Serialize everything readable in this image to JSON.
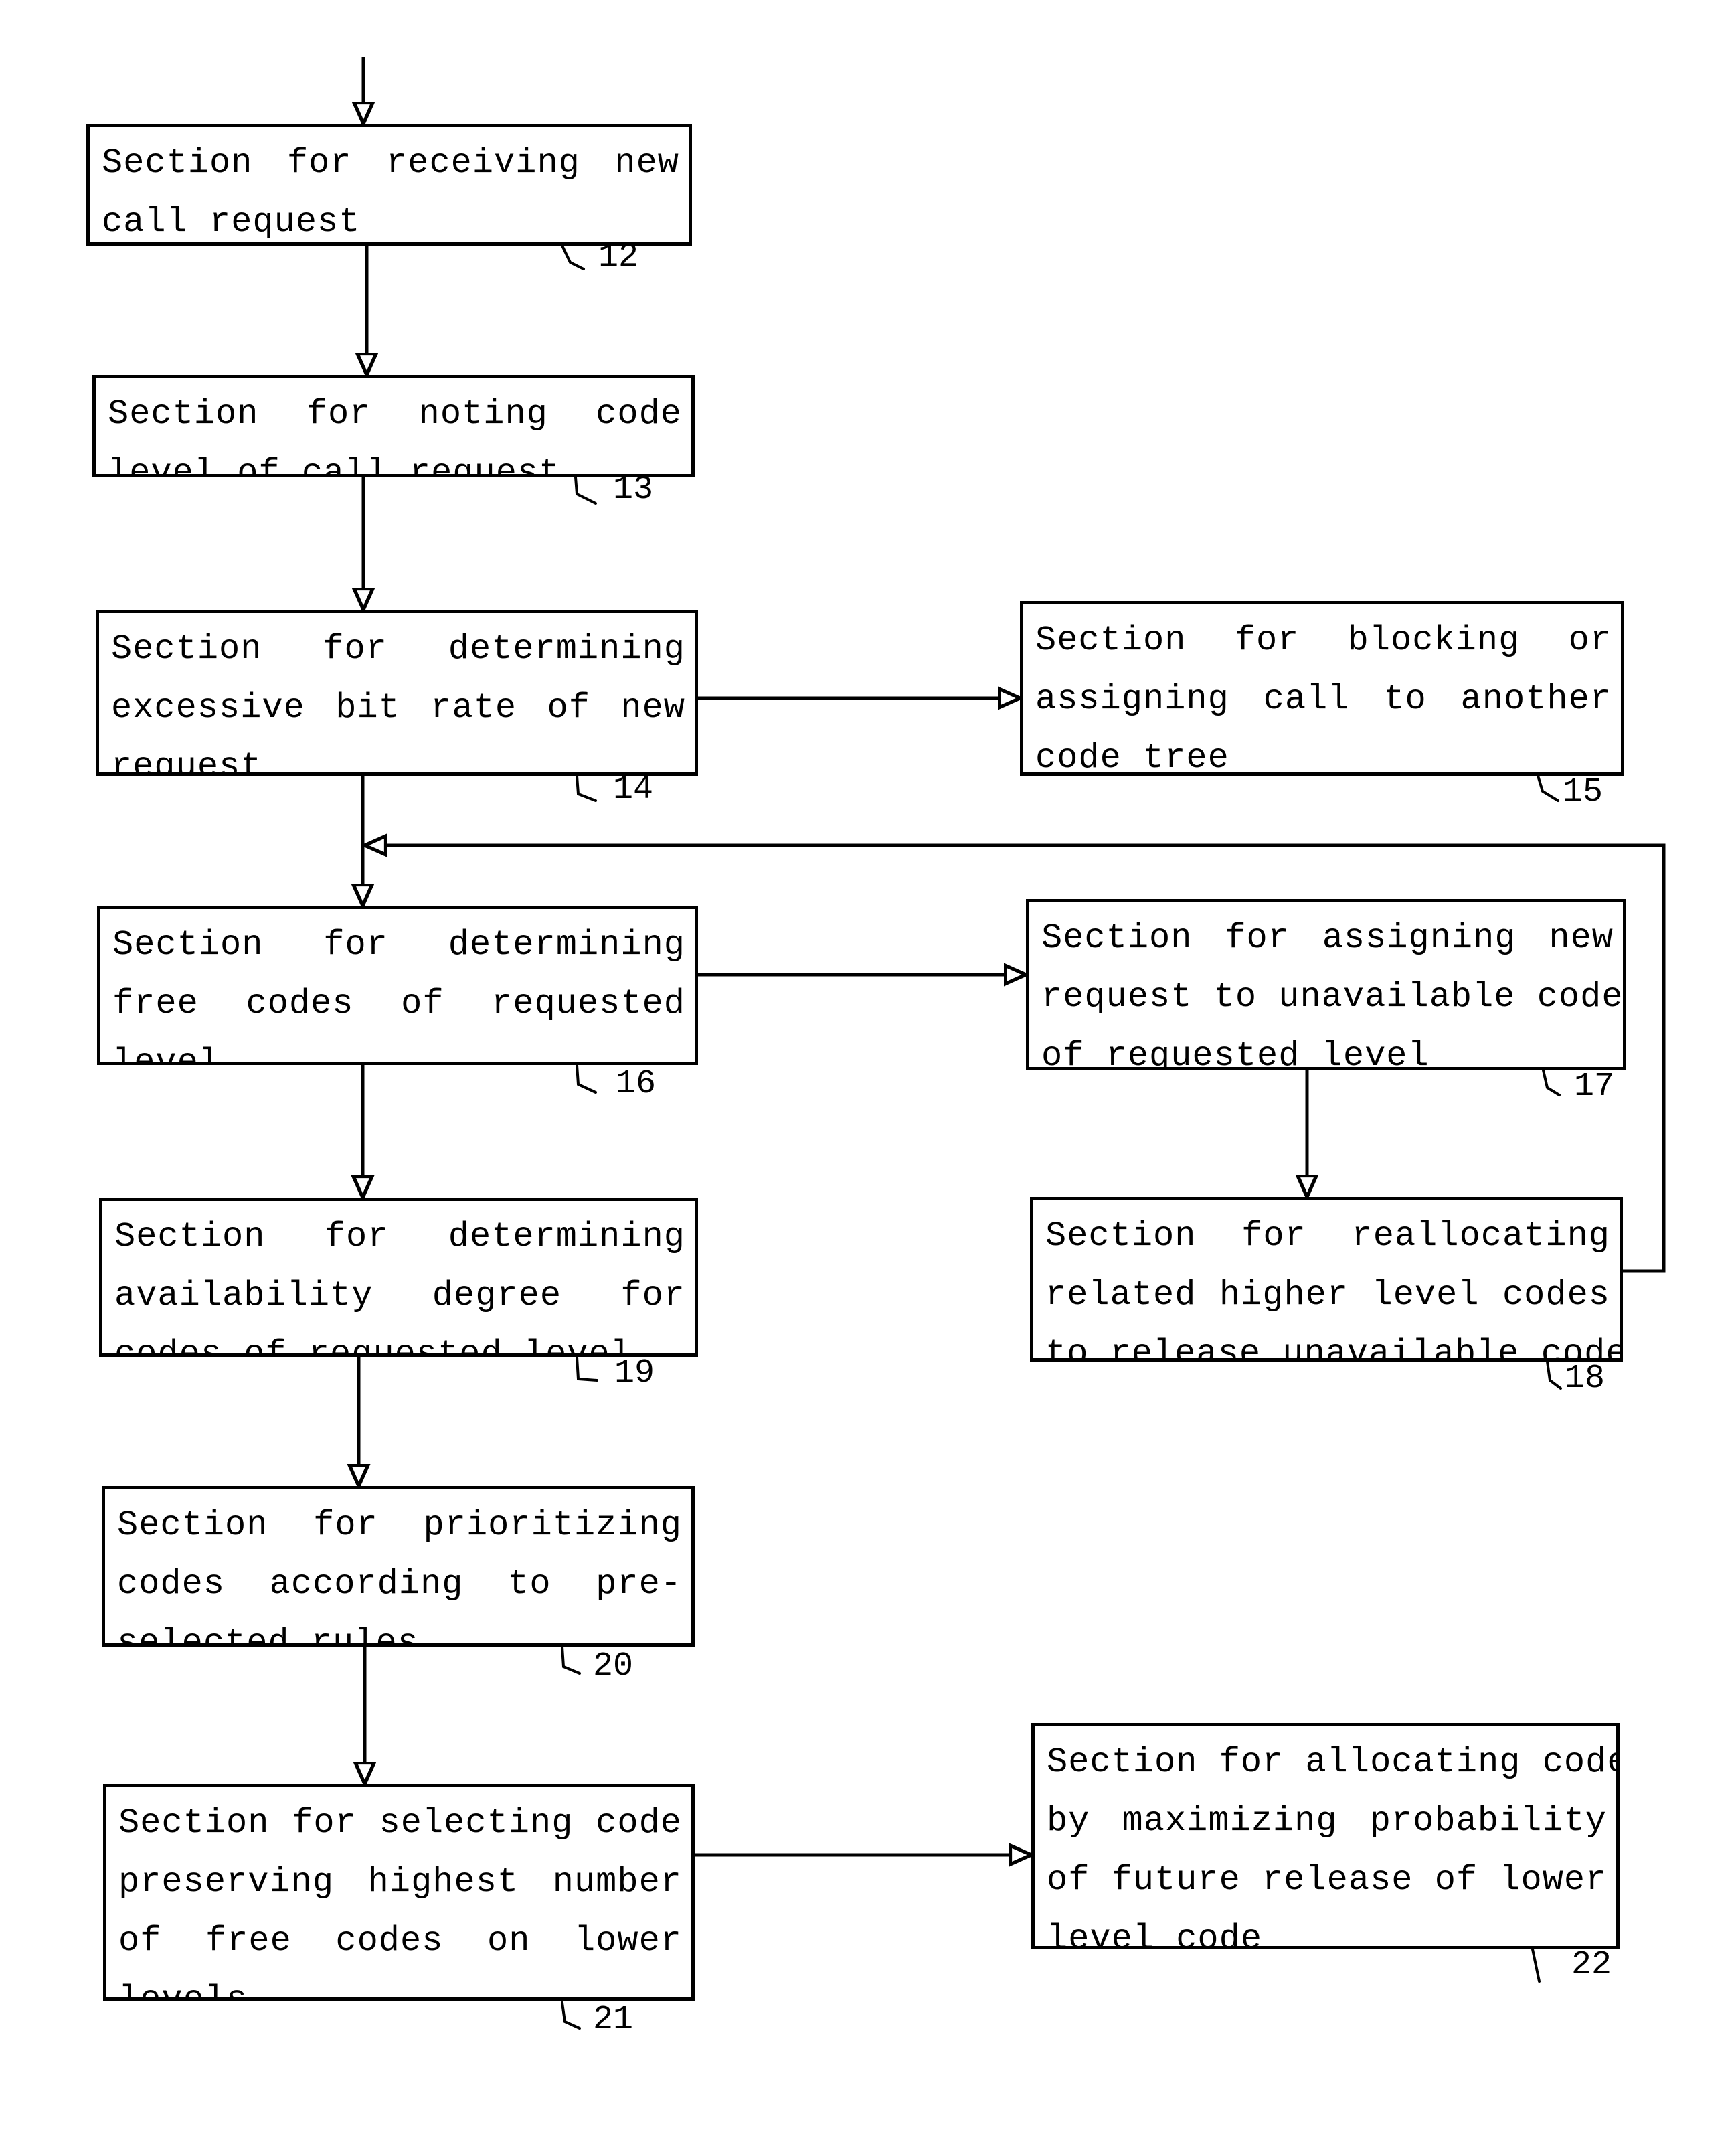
{
  "diagram": {
    "type": "flowchart",
    "blocks": [
      {
        "id": "12",
        "ref": "12",
        "lines": [
          "Section for receiving new",
          "call request"
        ]
      },
      {
        "id": "13",
        "ref": "13",
        "lines": [
          "Section for noting code",
          "level of call request"
        ]
      },
      {
        "id": "14",
        "ref": "14",
        "lines": [
          "Section for determining",
          "excessive bit rate of new",
          "request"
        ]
      },
      {
        "id": "15",
        "ref": "15",
        "lines": [
          "Section for blocking or",
          "assigning call to another",
          "code tree"
        ]
      },
      {
        "id": "16",
        "ref": "16",
        "lines": [
          "Section for determining",
          "free codes of requested",
          "level"
        ]
      },
      {
        "id": "17",
        "ref": "17",
        "lines": [
          "Section for assigning new",
          "request to unavailable code",
          "of requested level"
        ]
      },
      {
        "id": "18",
        "ref": "18",
        "lines": [
          "Section for reallocating",
          "related higher level codes",
          "to release unavailable code"
        ]
      },
      {
        "id": "19",
        "ref": "19",
        "lines": [
          "Section for determining",
          "availability degree for",
          "codes of requested level"
        ]
      },
      {
        "id": "20",
        "ref": "20",
        "lines": [
          "Section for prioritizing",
          "codes according to pre-",
          "selected rules"
        ]
      },
      {
        "id": "21",
        "ref": "21",
        "lines": [
          "Section for selecting code",
          "preserving highest number",
          "of free codes on lower",
          "levels"
        ]
      },
      {
        "id": "22",
        "ref": "22",
        "lines": [
          "Section for allocating code",
          "by maximizing probability",
          "of future release of lower",
          "level code"
        ]
      }
    ],
    "connections": [
      {
        "from": "start",
        "to": "12"
      },
      {
        "from": "12",
        "to": "13"
      },
      {
        "from": "13",
        "to": "14"
      },
      {
        "from": "14",
        "to": "15"
      },
      {
        "from": "14",
        "to": "16"
      },
      {
        "from": "16",
        "to": "17"
      },
      {
        "from": "16",
        "to": "19"
      },
      {
        "from": "17",
        "to": "18"
      },
      {
        "from": "18",
        "to": "16"
      },
      {
        "from": "19",
        "to": "20"
      },
      {
        "from": "20",
        "to": "21"
      },
      {
        "from": "21",
        "to": "22"
      }
    ]
  }
}
